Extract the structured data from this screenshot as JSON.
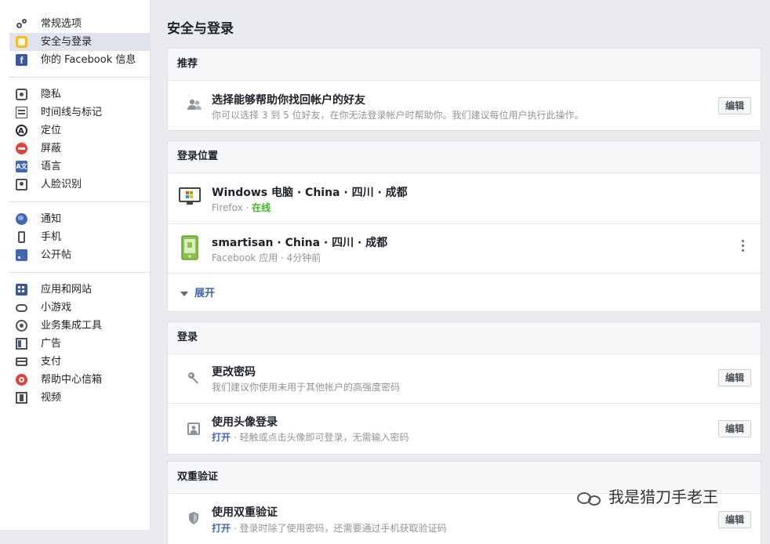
{
  "sidebar": {
    "group1": [
      {
        "label": "常规选项",
        "icon": "gears-icon"
      },
      {
        "label": "安全与登录",
        "icon": "lock-icon",
        "active": true
      },
      {
        "label": "你的 Facebook 信息",
        "icon": "facebook-icon"
      }
    ],
    "group2": [
      {
        "label": "隐私",
        "icon": "privacy-icon"
      },
      {
        "label": "时间线与标记",
        "icon": "timeline-icon"
      },
      {
        "label": "定位",
        "icon": "location-icon"
      },
      {
        "label": "屏蔽",
        "icon": "block-icon"
      },
      {
        "label": "语言",
        "icon": "language-icon"
      },
      {
        "label": "人脸识别",
        "icon": "face-recognition-icon"
      }
    ],
    "group3": [
      {
        "label": "通知",
        "icon": "globe-icon"
      },
      {
        "label": "手机",
        "icon": "phone-icon"
      },
      {
        "label": "公开帖",
        "icon": "rss-icon"
      }
    ],
    "group4": [
      {
        "label": "应用和网站",
        "icon": "apps-icon"
      },
      {
        "label": "小游戏",
        "icon": "gamepad-icon"
      },
      {
        "label": "业务集成工具",
        "icon": "business-icon"
      },
      {
        "label": "广告",
        "icon": "ads-icon"
      },
      {
        "label": "支付",
        "icon": "payment-icon"
      },
      {
        "label": "帮助中心信箱",
        "icon": "help-icon"
      },
      {
        "label": "视频",
        "icon": "video-icon"
      }
    ],
    "fb_glyph": "f",
    "lang_glyph": "A文"
  },
  "main": {
    "title": "安全与登录",
    "recommended": {
      "heading": "推荐",
      "row": {
        "title": "选择能够帮助你找回帐户的好友",
        "subtitle": "你可以选择 3 到 5 位好友，在你无法登录帐户时帮助你。我们建议每位用户执行此操作。",
        "edit": "编辑"
      }
    },
    "where_logged_in": {
      "heading": "登录位置",
      "sessions": [
        {
          "title": "Windows 电脑 · China · 四川 · 成都",
          "client": "Firefox · ",
          "status": "在线"
        },
        {
          "title": "smartisan · China · 四川 · 成都",
          "client": "Facebook 应用 · 4分钟前"
        }
      ],
      "expand": "展开"
    },
    "login": {
      "heading": "登录",
      "rows": [
        {
          "title": "更改密码",
          "subtitle": "我们建议你使用未用于其他帐户的高强度密码",
          "edit": "编辑"
        },
        {
          "title": "使用头像登录",
          "status": "打开",
          "subtitle": " · 轻触或点击头像即可登录，无需输入密码",
          "edit": "编辑"
        }
      ]
    },
    "two_factor": {
      "heading": "双重验证",
      "row": {
        "title": "使用双重验证",
        "status": "打开",
        "subtitle": " · 登录时除了使用密码，还需要通过手机获取验证码",
        "edit": "编辑"
      }
    }
  },
  "watermark": "我是猎刀手老王"
}
